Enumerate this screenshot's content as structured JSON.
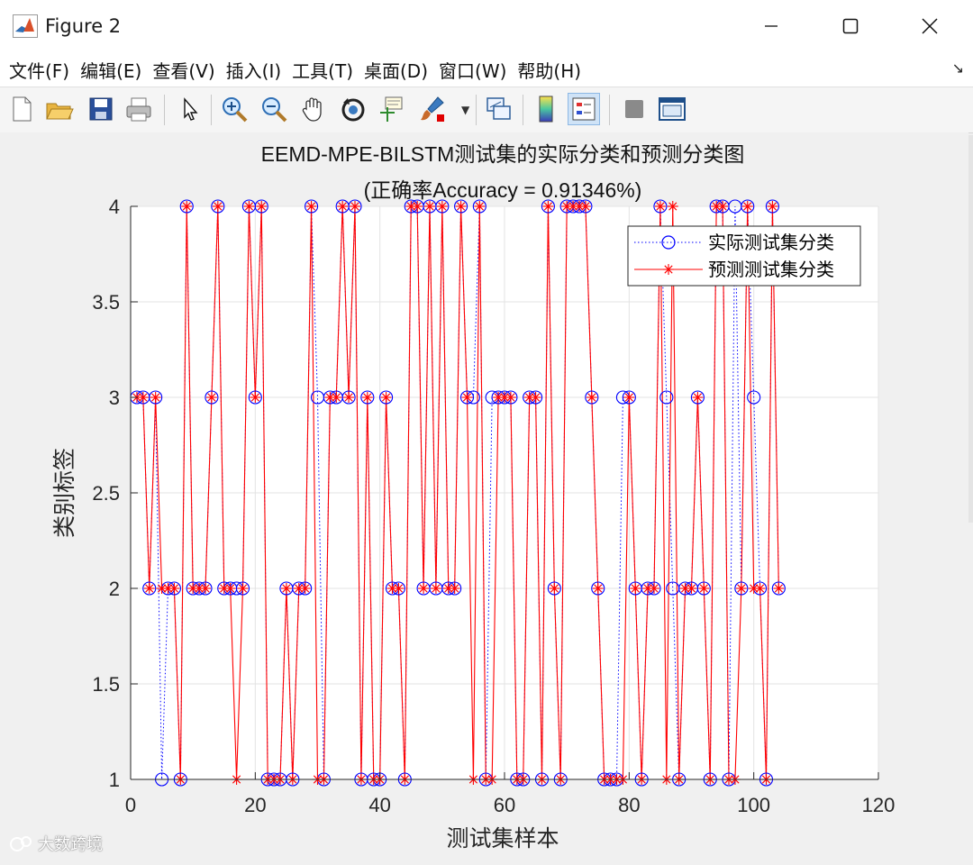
{
  "window": {
    "title": "Figure 2",
    "minimize_icon": "minimize-icon",
    "maximize_icon": "maximize-icon",
    "close_icon": "close-icon"
  },
  "menu": [
    {
      "label": "文件(F)"
    },
    {
      "label": "编辑(E)"
    },
    {
      "label": "查看(V)"
    },
    {
      "label": "插入(I)"
    },
    {
      "label": "工具(T)"
    },
    {
      "label": "桌面(D)"
    },
    {
      "label": "窗口(W)"
    },
    {
      "label": "帮助(H)"
    }
  ],
  "menu_arrow": "↘",
  "toolbar_icons": [
    "new-figure-icon",
    "open-icon",
    "save-icon",
    "print-icon",
    "pointer-icon",
    "zoom-in-icon",
    "zoom-out-icon",
    "pan-hand-icon",
    "rotate-3d-icon",
    "data-cursor-icon",
    "brush-icon",
    "link-plot-icon",
    "colorbar-icon",
    "legend-icon",
    "hide-plot-tools-icon",
    "show-plot-tools-icon"
  ],
  "watermark": "大数跨境",
  "chart_data": {
    "type": "line",
    "title": "EEMD-MPE-BILSTM测试集的实际分类和预测分类图",
    "subtitle": "(正确率Accuracy = 0.91346%)",
    "xlabel": "测试集样本",
    "ylabel": "类别标签",
    "xlim": [
      0,
      120
    ],
    "ylim": [
      1,
      4
    ],
    "xticks": [
      0,
      20,
      40,
      60,
      80,
      100,
      120
    ],
    "yticks": [
      1,
      1.5,
      2,
      2.5,
      3,
      3.5,
      4
    ],
    "grid": true,
    "legend_position": "top-right",
    "x": [
      1,
      2,
      3,
      4,
      5,
      6,
      7,
      8,
      9,
      10,
      11,
      12,
      13,
      14,
      15,
      16,
      17,
      18,
      19,
      20,
      21,
      22,
      23,
      24,
      25,
      26,
      27,
      28,
      29,
      30,
      31,
      32,
      33,
      34,
      35,
      36,
      37,
      38,
      39,
      40,
      41,
      42,
      43,
      44,
      45,
      46,
      47,
      48,
      49,
      50,
      51,
      52,
      53,
      54,
      55,
      56,
      57,
      58,
      59,
      60,
      61,
      62,
      63,
      64,
      65,
      66,
      67,
      68,
      69,
      70,
      71,
      72,
      73,
      74,
      75,
      76,
      77,
      78,
      79,
      80,
      81,
      82,
      83,
      84,
      85,
      86,
      87,
      88,
      89,
      90,
      91,
      92,
      93,
      94,
      95,
      96,
      97,
      98,
      99,
      100,
      101,
      102,
      103,
      104
    ],
    "series": [
      {
        "name": "实际测试集分类",
        "color": "#0000ff",
        "line_style": "dotted",
        "marker": "circle",
        "values": [
          3,
          3,
          2,
          3,
          1,
          2,
          2,
          1,
          4,
          2,
          2,
          2,
          3,
          4,
          2,
          2,
          2,
          2,
          4,
          3,
          4,
          1,
          1,
          1,
          2,
          1,
          2,
          2,
          4,
          3,
          1,
          3,
          3,
          4,
          3,
          4,
          1,
          3,
          1,
          1,
          3,
          2,
          2,
          1,
          4,
          4,
          2,
          4,
          2,
          4,
          2,
          2,
          4,
          3,
          3,
          4,
          1,
          3,
          3,
          3,
          3,
          1,
          1,
          3,
          3,
          1,
          4,
          2,
          1,
          4,
          4,
          4,
          4,
          3,
          2,
          1,
          1,
          1,
          3,
          3,
          2,
          1,
          2,
          2,
          4,
          3,
          2,
          1,
          2,
          2,
          3,
          2,
          1,
          4,
          4,
          1,
          4,
          2,
          4,
          3,
          2,
          1,
          4,
          2
        ]
      },
      {
        "name": "预测测试集分类",
        "color": "#ff0000",
        "line_style": "solid",
        "marker": "asterisk",
        "values": [
          3,
          3,
          2,
          3,
          2,
          2,
          2,
          1,
          4,
          2,
          2,
          2,
          3,
          4,
          2,
          2,
          1,
          2,
          4,
          3,
          4,
          1,
          1,
          1,
          2,
          1,
          2,
          2,
          4,
          1,
          1,
          3,
          3,
          4,
          3,
          4,
          1,
          3,
          1,
          1,
          3,
          2,
          2,
          1,
          4,
          4,
          2,
          4,
          2,
          4,
          2,
          2,
          4,
          3,
          1,
          4,
          1,
          1,
          3,
          3,
          3,
          1,
          1,
          3,
          3,
          1,
          4,
          2,
          1,
          4,
          4,
          4,
          4,
          3,
          2,
          1,
          1,
          1,
          1,
          3,
          2,
          1,
          2,
          2,
          4,
          1,
          4,
          1,
          2,
          2,
          3,
          2,
          1,
          4,
          4,
          1,
          1,
          2,
          4,
          2,
          2,
          1,
          4,
          2
        ]
      }
    ]
  }
}
